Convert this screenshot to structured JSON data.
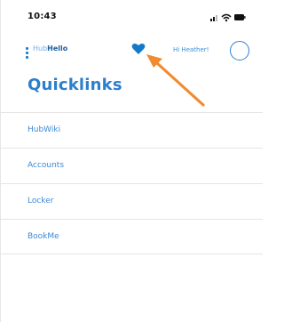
{
  "status_bar": {
    "time": "10:43"
  },
  "nav": {
    "brand_hub": "Hub",
    "brand_hello": "Hello",
    "greeting": "Hi Heather!"
  },
  "page": {
    "title": "Quicklinks"
  },
  "quicklinks": [
    {
      "label": "HubWiki"
    },
    {
      "label": "Accounts"
    },
    {
      "label": "Locker"
    },
    {
      "label": "BookMe"
    }
  ],
  "colors": {
    "accent": "#2d7fcb",
    "heart": "#1479c9",
    "arrow": "#f28a2e"
  },
  "icons": [
    "menu-icon",
    "heart-icon",
    "avatar",
    "signal-icon",
    "wifi-icon",
    "battery-icon"
  ]
}
